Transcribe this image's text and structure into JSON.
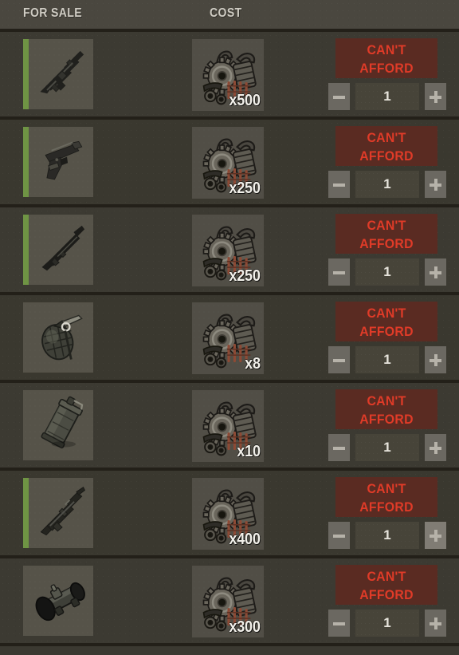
{
  "header": {
    "for_sale_label": "FOR SALE",
    "cost_label": "COST"
  },
  "colors": {
    "rarity_green": "#6f9444",
    "cant_afford_bg": "#5a2b22",
    "cant_afford_text": "#e03b28",
    "row_bg": "#3c3a32",
    "separator": "#232019",
    "tile_bg": "#565349",
    "step_button": "#6b6861",
    "step_button_hover": "#807c74",
    "qty_field_bg": "#474439"
  },
  "rows": [
    {
      "item_icon": "assault-rifle-icon",
      "item_name": "assault-rifle",
      "has_rarity_bar": true,
      "cost_icon": "scrap-parts-icon",
      "cost_qty": "x500",
      "buy_label_line1": "CAN'T",
      "buy_label_line2": "AFFORD",
      "quantity": "1",
      "minus_label": "minus",
      "plus_label": "plus",
      "plus_highlighted": false
    },
    {
      "item_icon": "pistol-icon",
      "item_name": "pistol",
      "has_rarity_bar": true,
      "cost_icon": "scrap-parts-icon",
      "cost_qty": "x250",
      "buy_label_line1": "CAN'T",
      "buy_label_line2": "AFFORD",
      "quantity": "1",
      "minus_label": "minus",
      "plus_label": "plus",
      "plus_highlighted": false
    },
    {
      "item_icon": "shotgun-icon",
      "item_name": "shotgun",
      "has_rarity_bar": true,
      "cost_icon": "scrap-parts-icon",
      "cost_qty": "x250",
      "buy_label_line1": "CAN'T",
      "buy_label_line2": "AFFORD",
      "quantity": "1",
      "minus_label": "minus",
      "plus_label": "plus",
      "plus_highlighted": false
    },
    {
      "item_icon": "grenade-icon",
      "item_name": "frag-grenade",
      "has_rarity_bar": false,
      "cost_icon": "scrap-parts-icon",
      "cost_qty": "x8",
      "buy_label_line1": "CAN'T",
      "buy_label_line2": "AFFORD",
      "quantity": "1",
      "minus_label": "minus",
      "plus_label": "plus",
      "plus_highlighted": false
    },
    {
      "item_icon": "smoke-canister-icon",
      "item_name": "smoke-grenade",
      "has_rarity_bar": false,
      "cost_icon": "scrap-parts-icon",
      "cost_qty": "x10",
      "buy_label_line1": "CAN'T",
      "buy_label_line2": "AFFORD",
      "quantity": "1",
      "minus_label": "minus",
      "plus_label": "plus",
      "plus_highlighted": false
    },
    {
      "item_icon": "ak-rifle-icon",
      "item_name": "ak-rifle",
      "has_rarity_bar": true,
      "cost_icon": "scrap-parts-icon",
      "cost_qty": "x400",
      "buy_label_line1": "CAN'T",
      "buy_label_line2": "AFFORD",
      "quantity": "1",
      "minus_label": "minus",
      "plus_label": "plus",
      "plus_highlighted": true
    },
    {
      "item_icon": "rifle-scope-icon",
      "item_name": "rifle-scope",
      "has_rarity_bar": false,
      "cost_icon": "scrap-parts-icon",
      "cost_qty": "x300",
      "buy_label_line1": "CAN'T",
      "buy_label_line2": "AFFORD",
      "quantity": "1",
      "minus_label": "minus",
      "plus_label": "plus",
      "plus_highlighted": false
    }
  ]
}
